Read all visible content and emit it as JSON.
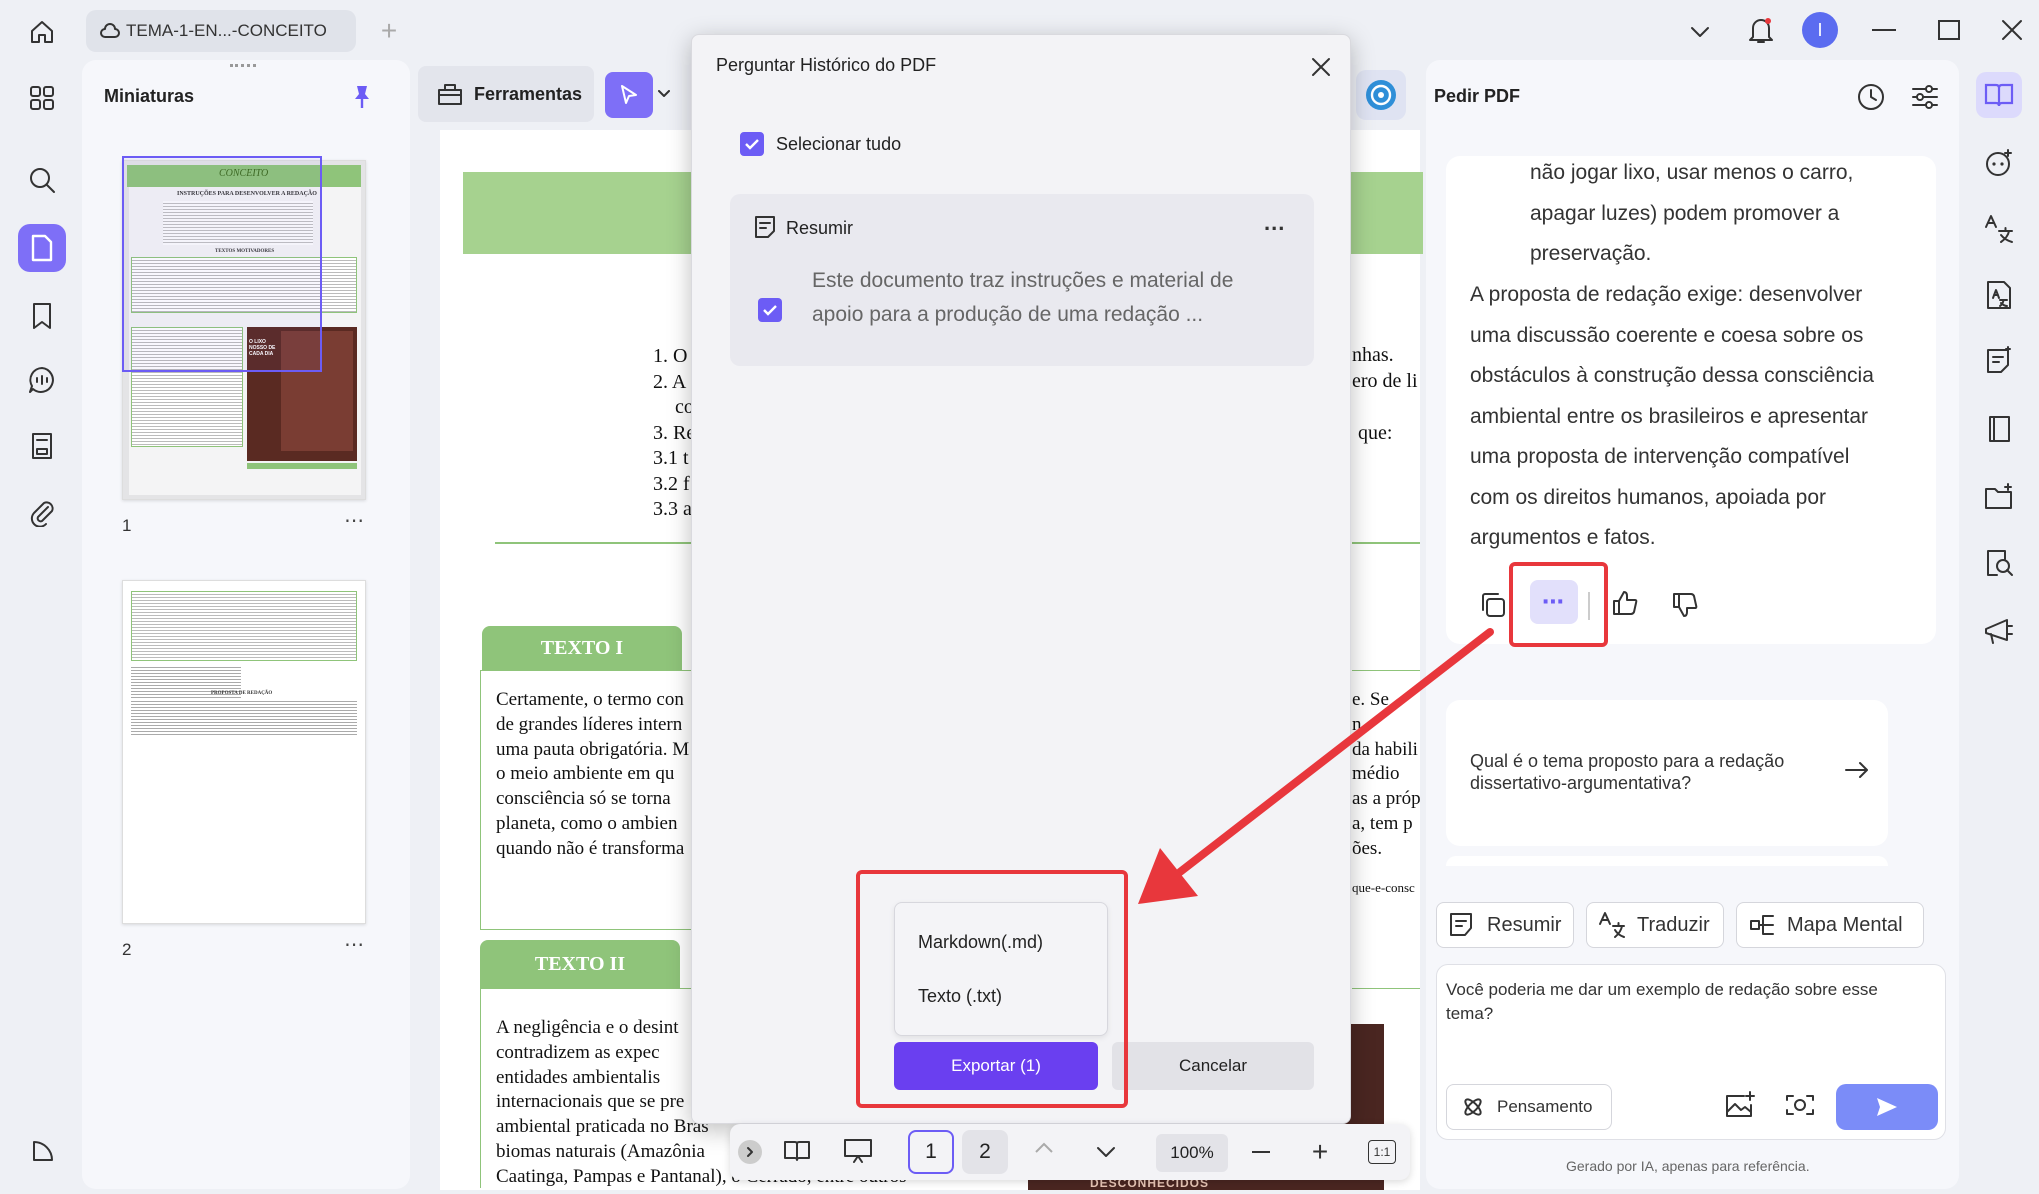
{
  "titlebar": {
    "tab_title": "TEMA-1-EN...-CONCEITO",
    "user_initial": "I"
  },
  "thumbnails": {
    "title": "Miniaturas",
    "pages": [
      {
        "number": "1"
      },
      {
        "number": "2"
      }
    ],
    "thumb_text": {
      "p1_heading": "CONCEITO",
      "p1_title": "INSTRUÇÕES PARA DESENVOLVER A REDAÇÃO",
      "p1_motivadores": "TEXTOS MOTIVADORES",
      "p1_infographic": "O LIXO NOSSO DE CADA DIA",
      "p2_title": "PROPOSTA DE REDAÇÃO"
    }
  },
  "toolbar": {
    "tools_label": "Ferramentas"
  },
  "document": {
    "list_items": [
      "1. O",
      "2. A",
      "co",
      "3. Re",
      "3.1 t",
      "3.2 f",
      "3.3 a"
    ],
    "right_fragments": [
      "nhas.",
      "ero de li",
      "que:"
    ],
    "texto1": {
      "label": "TEXTO I",
      "lines": [
        "Certamente, o termo con",
        "de grandes líderes intern",
        "uma pauta obrigatória. M",
        "o meio ambiente em qu",
        "consciência só se torna",
        "planeta, como o ambien",
        "quando não é transforma"
      ],
      "right_lines": [
        "e. Se",
        "n",
        "da habili",
        "médio",
        "as a próp",
        "a, tem p",
        "ões."
      ],
      "link_fragment": "que-e-consc"
    },
    "texto2": {
      "label": "TEXTO II",
      "lines": [
        "A negligência e o desint",
        "contradizem   as   expec",
        "entidades      ambientalis",
        "internacionais que se pre",
        "ambiental praticada no Bras",
        "biomas naturais (Amazônia",
        "Caatinga, Pampas e Pantanal), o Cerrado, entre outros"
      ],
      "right_fragment": "DESCONHECIDOS"
    }
  },
  "bottom_toolbar": {
    "pages": [
      "1",
      "2"
    ],
    "zoom": "100%",
    "fit_label": "1:1"
  },
  "modal": {
    "title": "Perguntar Histórico do PDF",
    "select_all": "Selecionar tudo",
    "card": {
      "title": "Resumir",
      "more": "...",
      "text": "Este documento traz instruções e material de apoio para a produção de uma redação ..."
    },
    "export_options": [
      "Markdown(.md)",
      "Texto (.txt)"
    ],
    "export_button": "Exportar (1)",
    "cancel_button": "Cancelar"
  },
  "ai_panel": {
    "title": "Pedir PDF",
    "answer_indented": [
      "não jogar lixo, usar menos o carro,",
      "apagar luzes) podem promover a",
      "preservação."
    ],
    "answer_lines": [
      "A proposta de redação exige: desenvolver",
      "uma discussão coerente e coesa sobre os",
      "obstáculos à construção dessa consciência",
      "ambiental entre os brasileiros e apresentar",
      "uma proposta de intervenção compatível",
      "com os direitos humanos, apoiada por",
      "argumentos e fatos."
    ],
    "suggestion": [
      "Qual é o tema proposto para a redação",
      "dissertativo-argumentativa?"
    ],
    "quick_actions": [
      "Resumir",
      "Traduzir",
      "Mapa Mental"
    ],
    "input_text": "Você poderia me dar um exemplo de redação sobre esse tema?",
    "thinking_button": "Pensamento",
    "footer": "Gerado por IA, apenas para referência."
  },
  "colors": {
    "accent": "#6c5cf5",
    "highlight": "#e8373c",
    "doc_green": "#8fc47a"
  }
}
